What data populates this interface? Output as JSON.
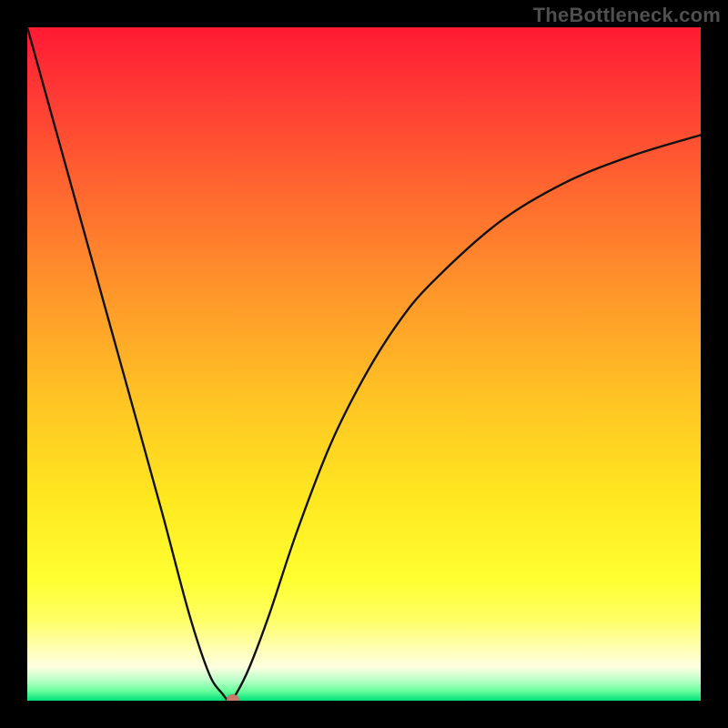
{
  "watermark": {
    "text": "TheBottleneck.com"
  },
  "chart_data": {
    "type": "line",
    "title": "",
    "xlabel": "",
    "ylabel": "",
    "xlim": [
      0,
      100
    ],
    "ylim": [
      0,
      100
    ],
    "background_gradient": {
      "orientation": "vertical",
      "stops": [
        {
          "pos": 0.0,
          "color": "#ff1a33"
        },
        {
          "pos": 0.4,
          "color": "#ff982a"
        },
        {
          "pos": 0.7,
          "color": "#ffe820"
        },
        {
          "pos": 0.92,
          "color": "#ffffb0"
        },
        {
          "pos": 1.0,
          "color": "#00e07a"
        }
      ]
    },
    "series": [
      {
        "name": "bottleneck-curve",
        "x": [
          0,
          5,
          10,
          15,
          20,
          24,
          27,
          29,
          30,
          31,
          33,
          36,
          40,
          45,
          50,
          55,
          60,
          70,
          80,
          90,
          100
        ],
        "y": [
          100,
          82,
          64,
          46,
          28,
          13,
          4,
          1,
          0,
          1,
          5,
          13,
          25,
          38,
          48,
          56,
          62,
          71,
          77,
          81,
          84
        ]
      }
    ],
    "annotations": [
      {
        "name": "minimum-marker",
        "x": 30.5,
        "y": 0,
        "color": "#c97a6a"
      }
    ]
  }
}
